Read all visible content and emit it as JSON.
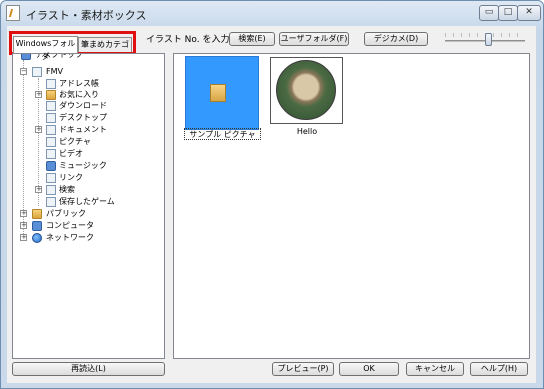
{
  "window": {
    "title": "イラスト・素材ボックス",
    "controls": {
      "minimize": "▭",
      "maximize": "□",
      "close": "✕"
    }
  },
  "toolbar": {
    "input_label": "イラスト No. を入力",
    "search_label": "検索(E)",
    "user_folder_label": "ユーザフォルダ(F)",
    "digicam_label": "デジカメ(D)",
    "thumbnail_size": 0.55
  },
  "tabs": {
    "windows_folder": "Windowsフォルダ",
    "category": "筆まめカテゴリ"
  },
  "tree": {
    "items": [
      {
        "label": "デスクトップ"
      },
      {
        "label": "FMV"
      },
      {
        "label": "アドレス帳"
      },
      {
        "label": "お気に入り"
      },
      {
        "label": "ダウンロード"
      },
      {
        "label": "デスクトップ"
      },
      {
        "label": "ドキュメント"
      },
      {
        "label": "ピクチャ"
      },
      {
        "label": "ビデオ"
      },
      {
        "label": "ミュージック"
      },
      {
        "label": "リンク"
      },
      {
        "label": "検索"
      },
      {
        "label": "保存したゲーム"
      },
      {
        "label": "パブリック"
      },
      {
        "label": "コンピュータ"
      },
      {
        "label": "ネットワーク"
      }
    ]
  },
  "content": {
    "items": [
      {
        "label": "サンプル ピクチャ"
      },
      {
        "label": "Hello"
      }
    ]
  },
  "footer": {
    "reload_label": "再読込(L)",
    "preview_label": "プレビュー(P)",
    "ok_label": "OK",
    "cancel_label": "キャンセル",
    "help_label": "ヘルプ(H)"
  },
  "colors": {
    "highlight_red": "#e01010",
    "selection_blue": "#3399ff"
  }
}
